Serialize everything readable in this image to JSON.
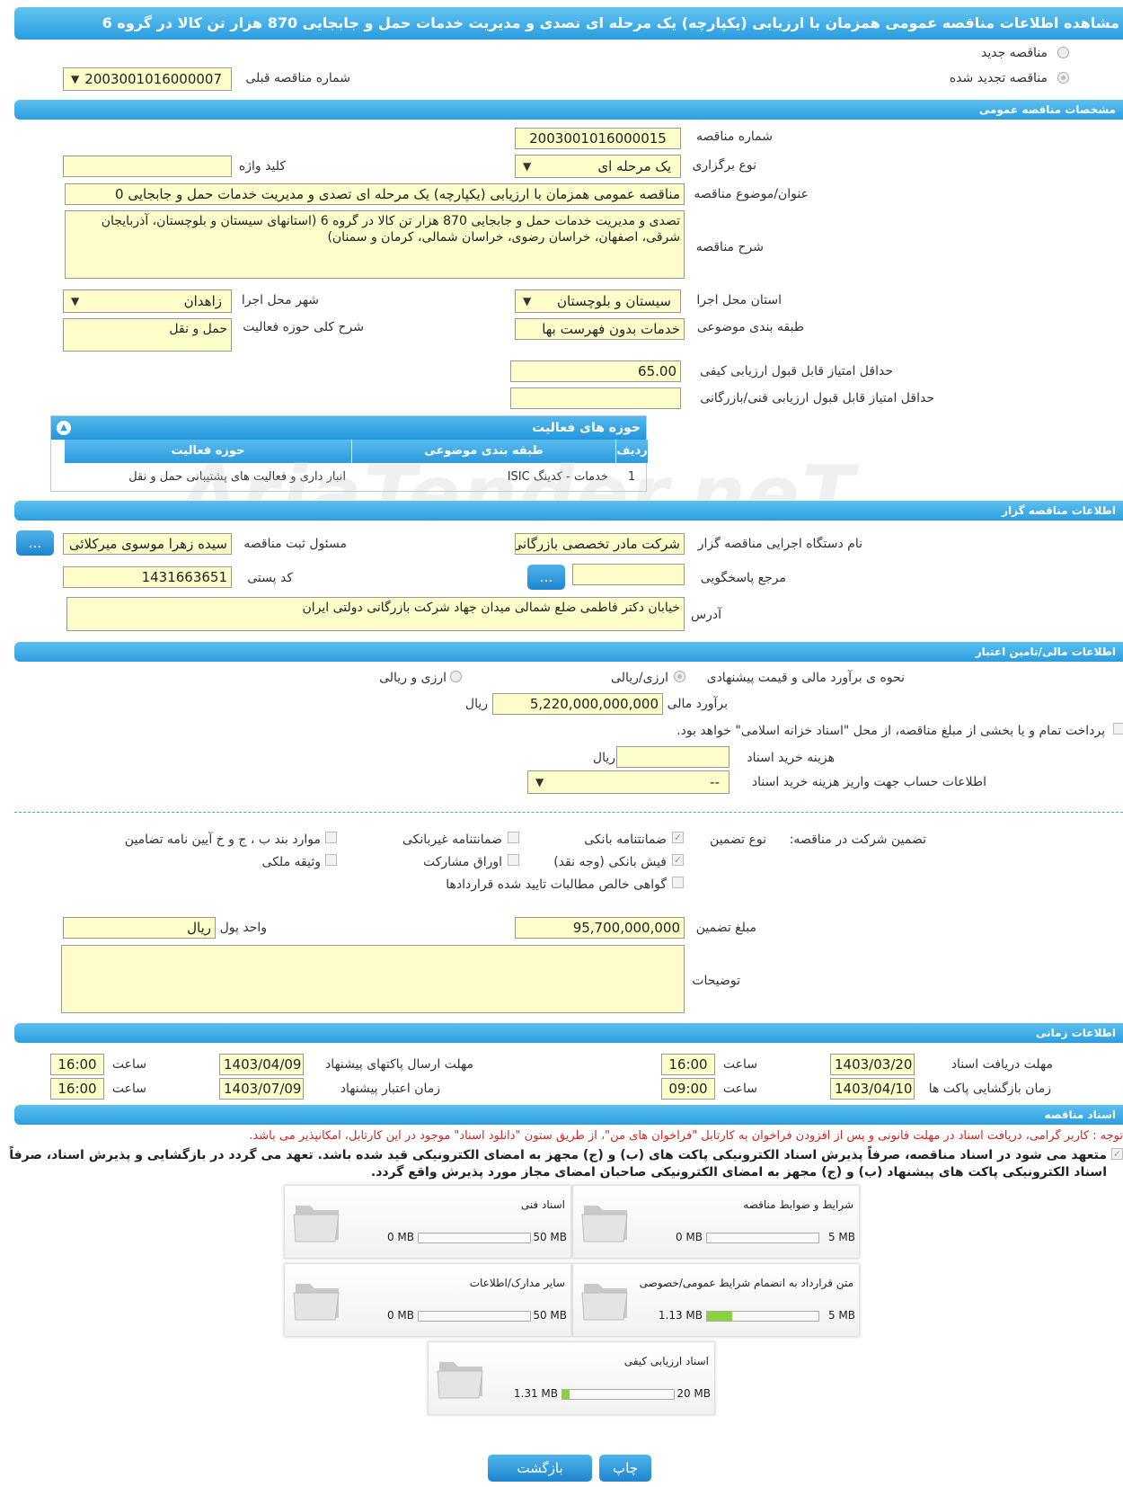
{
  "title": "مشاهده اطلاعات مناقصه عمومی همزمان با ارزیابی (یکپارچه) یک مرحله ای تصدی و مدیریت خدمات حمل و جابجایی 870 هزار تن کالا در گروه 6",
  "top": {
    "new_tender": "مناقصه جدید",
    "renewed_tender": "مناقصه تجدید شده",
    "prev_number_label": "شماره مناقصه قبلی",
    "prev_number": "2003001016000007"
  },
  "general": {
    "header": "مشخصات مناقصه عمومی",
    "number_label": "شماره مناقصه",
    "number": "2003001016000015",
    "type_label": "نوع برگزاری",
    "type": "یک مرحله ای",
    "keyword_label": "کلید واژه",
    "keyword": "",
    "subject_label": "عنوان/موضوع مناقصه",
    "subject": "مناقصه عمومی همزمان با ارزیابی (یکپارچه) یک مرحله ای تصدی و مدیریت خدمات حمل و جابجایی 0",
    "desc_label": "شرح مناقصه",
    "desc": "تصدی و مدیریت خدمات حمل و جابجایی 870 هزار تن کالا در گروه 6 (استانهای سیستان و بلوچستان، آذربایجان شرقی، اصفهان، خراسان رضوی، خراسان شمالی، کرمان و سمنان)",
    "province_label": "استان محل اجرا",
    "province": "سیستان و بلوچستان",
    "city_label": "شهر محل اجرا",
    "city": "زاهدان",
    "category_label": "طبقه بندی موضوعی",
    "category": "خدمات بدون فهرست بها",
    "activity_label": "شرح کلی حوزه فعالیت",
    "activity": "حمل و نقل",
    "min_quality_label": "حداقل امتیاز قابل قبول ارزیابی کیفی",
    "min_quality": "65.00",
    "min_tech_label": "حداقل امتیاز قابل قبول ارزیابی فنی/بازرگانی",
    "min_tech": ""
  },
  "activity_grid": {
    "header": "حوزه های فعالیت",
    "col_row": "ردیف",
    "col_category": "طبقه بندی موضوعی",
    "col_activity": "حوزه فعالیت",
    "rows": [
      {
        "row": "1",
        "category": "خدمات - کدینگ ISIC",
        "activity": "انبار داری و فعالیت های پشتیبانی حمل و نقل"
      }
    ]
  },
  "organizer": {
    "header": "اطلاعات مناقصه گزار",
    "org_label": "نام دستگاه اجرایی مناقصه گزار",
    "org": "شرکت مادر تخصصی بازرگانی",
    "responsible_label": "مسئول ثبت مناقصه",
    "responsible": "سیده زهرا موسوی میرکلائی",
    "ref_label": "مرجع پاسخگویی",
    "ref": "",
    "postal_label": "کد پستی",
    "postal": "1431663651",
    "address_label": "آدرس",
    "address": "خیابان دکتر فاطمی ضلع شمالی میدان جهاد شرکت بازرگانی دولتی ایران",
    "more_btn": "..."
  },
  "finance": {
    "header": "اطلاعات مالی/تامین اعتبار",
    "method_label": "نحوه ی برآورد مالی و قیمت پیشنهادی",
    "opt_foreign": "ارزی/ریالی",
    "opt_both": "ارزی و ریالی",
    "estimate_label": "برآورد مالی",
    "estimate": "5,220,000,000,000",
    "rial": "ریال",
    "treasury_text": "پرداخت تمام و یا بخشی از مبلغ مناقصه، از محل \"اسناد خزانه اسلامی\" خواهد بود.",
    "doc_cost_label": "هزینه خرید اسناد",
    "doc_cost": "",
    "account_label": "اطلاعات حساب جهت واریز هزینه خرید اسناد",
    "account": "--"
  },
  "guarantee": {
    "title": "تضمین شرکت در مناقصه:",
    "type_label": "نوع تضمین",
    "bank_guarantee": "ضمانتنامه بانکی",
    "non_bank": "ضمانتنامه غیربانکی",
    "regulation": "موارد بند ب ، ج و خ آیین نامه تضامین",
    "bank_receipt": "فیش بانکی (وجه نقد)",
    "bonds": "اوراق مشارکت",
    "property": "وثیقه ملکی",
    "certificate": "گواهی خالص مطالبات تایید شده قراردادها",
    "amount_label": "مبلغ تضمین",
    "amount": "95,700,000,000",
    "currency_label": "واحد پول",
    "currency": "ریال",
    "notes_label": "توضیحات",
    "notes": ""
  },
  "schedule": {
    "header": "اطلاعات زمانی",
    "doc_deadline_label": "مهلت دریافت اسناد",
    "doc_deadline": "1403/03/20",
    "doc_deadline_time": "16:00",
    "submit_deadline_label": "مهلت ارسال پاکتهای پیشنهاد",
    "submit_deadline": "1403/04/09",
    "submit_deadline_time": "16:00",
    "opening_label": "زمان بازگشایی پاکت ها",
    "opening": "1403/04/10",
    "opening_time": "09:00",
    "validity_label": "زمان اعتبار پیشنهاد",
    "validity": "1403/07/09",
    "validity_time": "16:00",
    "time_label": "ساعت"
  },
  "documents": {
    "header": "اسناد مناقصه",
    "notice": "توجه : کاربر گرامی، دریافت اسناد در مهلت قانونی و پس از افزودن فراخوان به کارتابل \"فراخوان های من\"، از طریق ستون \"دانلود اسناد\" موجود در این کارتابل، امکانپذیر می باشد.",
    "commitment": "متعهد می شود در اسناد مناقصه، صرفاً پذیرش اسناد الکترونیکی پاکت های (ب) و (ج) مجهز به امضای الکترونیکی قید شده باشد. تعهد می گردد در بازگشایی و پذیرش اسناد، صرفاً اسناد الکترونیکی پاکت های پیشنهاد (ب) و (ج) مجهز به امضای الکترونیکی صاحبان امضای مجاز مورد پذیرش واقع گردد.",
    "items": [
      {
        "name": "شرایط و ضوابط مناقصه",
        "used": "0 MB",
        "max": "5 MB",
        "ratio": 0
      },
      {
        "name": "اسناد فنی",
        "used": "0 MB",
        "max": "50 MB",
        "ratio": 0
      },
      {
        "name": "متن قرارداد به انضمام شرایط عمومی/خصوصی",
        "used": "1.13 MB",
        "max": "5 MB",
        "ratio": 0.226
      },
      {
        "name": "سایر مدارک/اطلاعات",
        "used": "0 MB",
        "max": "50 MB",
        "ratio": 0
      },
      {
        "name": "اسناد ارزیابی کیفی",
        "used": "1.31 MB",
        "max": "20 MB",
        "ratio": 0.0655
      }
    ]
  },
  "buttons": {
    "print": "چاپ",
    "back": "بازگشت"
  },
  "watermark": "AriaTender.neT",
  "colors": {
    "accent": "#2a9ddf",
    "field": "#fdfdc9",
    "notice": "#d9231c"
  }
}
